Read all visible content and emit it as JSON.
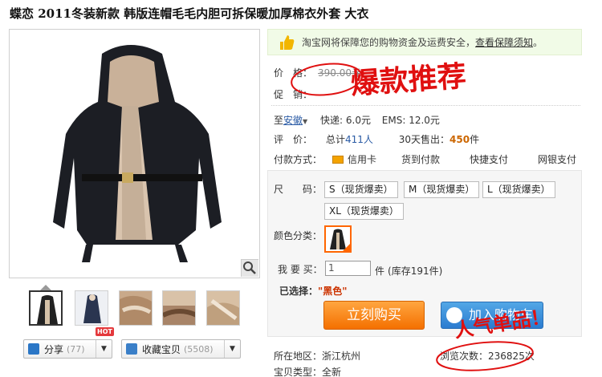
{
  "title": "蝶恋 2011冬装新款 韩版连帽毛毛内胆可拆保暖加厚棉衣外套 大衣",
  "share": {
    "label": "分享",
    "count": "(77)",
    "hot": "HOT"
  },
  "favorite": {
    "label": "收藏宝贝",
    "count": "(5508)"
  },
  "safety": {
    "text": "淘宝网将保障您的购物资金及运费安全，",
    "link": "查看保障须知",
    "end": "。"
  },
  "price": {
    "label": "价　格：",
    "value": "390.00元"
  },
  "promo": {
    "label": "促　销："
  },
  "shipping": {
    "to_prefix": "至",
    "to_place": "安徽",
    "arrow": "▼",
    "express": "快递: 6.0元",
    "ems": "EMS: 12.0元"
  },
  "review": {
    "label": "评　价：",
    "total_prefix": "总计",
    "total_value": "411人",
    "sold_prefix": "30天售出：",
    "sold_value": "450",
    "sold_unit": "件"
  },
  "payment": {
    "label": "付款方式：",
    "methods": [
      "信用卡",
      "货到付款",
      "快捷支付",
      "网银支付"
    ]
  },
  "size": {
    "label": "尺　　码：",
    "options": [
      "S（现货爆卖）",
      "M（现货爆卖）",
      "L（现货爆卖）",
      "XL（现货爆卖）"
    ]
  },
  "color": {
    "label": "颜色分类："
  },
  "quantity": {
    "label": "我 要 买：",
    "value": "1",
    "unit": "件",
    "stock": "(库存191件)"
  },
  "selected": {
    "label": "已选择：",
    "value": "\"黑色\""
  },
  "buy_now": "立刻购买",
  "add_cart": "加入购物车",
  "location": {
    "label": "所在地区：",
    "value": "浙江杭州"
  },
  "views": {
    "label": "浏览次数：",
    "value": "236825次"
  },
  "type": {
    "label": "宝贝类型：",
    "value": "全新"
  },
  "overlay": {
    "top": "爆款推荐",
    "bottom": "人气单品！"
  },
  "colors": {
    "accent": "#ff6600",
    "buy_button": "#f47000",
    "cart_button": "#2b7cd0",
    "annotation": "#e01010",
    "link": "#2a5ba5"
  }
}
